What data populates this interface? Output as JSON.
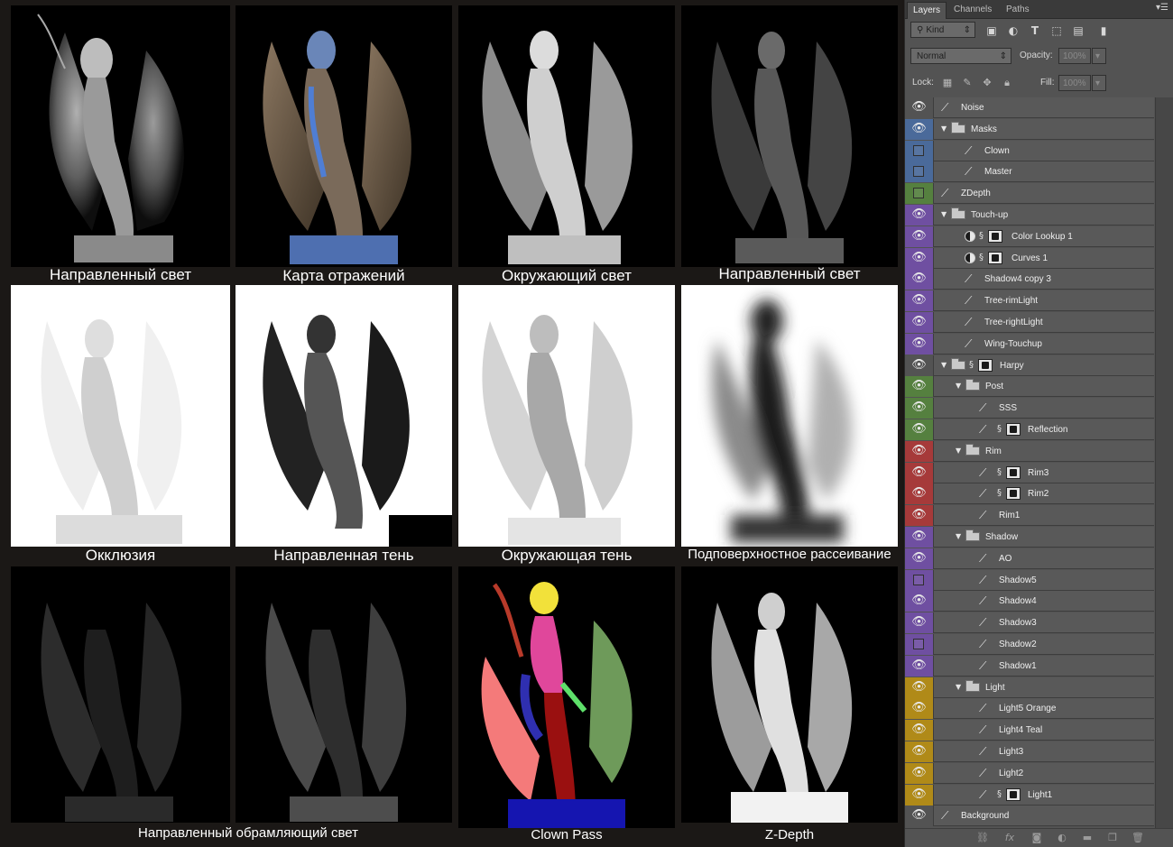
{
  "gallery": {
    "captions": [
      "Направленный свет",
      "Карта отражений",
      "Окружающий свет",
      "Направленный свет",
      "Окклюзия",
      "Направленная тень",
      "Окружающая тень",
      "Подповерхностное рассеивание",
      "Направленный обрамляющий свет",
      "Clown Pass",
      "Z-Depth"
    ]
  },
  "panel": {
    "tabs": [
      "Layers",
      "Channels",
      "Paths"
    ],
    "filter_kind": "Kind",
    "blend_mode": "Normal",
    "opacity_label": "Opacity:",
    "opacity_value": "100%",
    "lock_label": "Lock:",
    "fill_label": "Fill:",
    "fill_value": "100%"
  },
  "layers": [
    {
      "name": "Noise",
      "color": "none",
      "visible": true
    },
    {
      "name": "Masks",
      "color": "blue",
      "visible": true
    },
    {
      "name": "Clown",
      "color": "blue",
      "visible": false
    },
    {
      "name": "Master",
      "color": "blue",
      "visible": false
    },
    {
      "name": "ZDepth",
      "color": "green",
      "visible": false
    },
    {
      "name": "Touch-up",
      "color": "violet",
      "visible": true
    },
    {
      "name": "Color Lookup 1",
      "color": "violet",
      "visible": true
    },
    {
      "name": "Curves 1",
      "color": "violet",
      "visible": true
    },
    {
      "name": "Shadow4 copy 3",
      "color": "violet",
      "visible": true
    },
    {
      "name": "Tree-rimLight",
      "color": "violet",
      "visible": true
    },
    {
      "name": "Tree-rightLight",
      "color": "violet",
      "visible": true
    },
    {
      "name": "Wing-Touchup",
      "color": "violet",
      "visible": true
    },
    {
      "name": "Harpy",
      "color": "none",
      "visible": true
    },
    {
      "name": "Post",
      "color": "green",
      "visible": true
    },
    {
      "name": "SSS",
      "color": "green",
      "visible": true
    },
    {
      "name": "Reflection",
      "color": "green",
      "visible": true
    },
    {
      "name": "Rim",
      "color": "red",
      "visible": true
    },
    {
      "name": "Rim3",
      "color": "red",
      "visible": true
    },
    {
      "name": "Rim2",
      "color": "red",
      "visible": true
    },
    {
      "name": "Rim1",
      "color": "red",
      "visible": true
    },
    {
      "name": "Shadow",
      "color": "violet",
      "visible": true
    },
    {
      "name": "AO",
      "color": "violet",
      "visible": true
    },
    {
      "name": "Shadow5",
      "color": "violet",
      "visible": false
    },
    {
      "name": "Shadow4",
      "color": "violet",
      "visible": true
    },
    {
      "name": "Shadow3",
      "color": "violet",
      "visible": true
    },
    {
      "name": "Shadow2",
      "color": "violet",
      "visible": false
    },
    {
      "name": "Shadow1",
      "color": "violet",
      "visible": true
    },
    {
      "name": "Light",
      "color": "yellow",
      "visible": true
    },
    {
      "name": "Light5 Orange",
      "color": "yellow",
      "visible": true
    },
    {
      "name": "Light4 Teal",
      "color": "yellow",
      "visible": true
    },
    {
      "name": "Light3",
      "color": "yellow",
      "visible": true
    },
    {
      "name": "Light2",
      "color": "yellow",
      "visible": true
    },
    {
      "name": "Light1",
      "color": "yellow",
      "visible": true
    },
    {
      "name": "Background",
      "color": "none",
      "visible": true
    }
  ],
  "label_colors": {
    "blue": "#4a6a9a",
    "green": "#55803f",
    "violet": "#6f4fa1",
    "red": "#a63a3a",
    "yellow": "#b08a18",
    "none": "#535353"
  },
  "icons": {
    "eye": "eye-icon",
    "brush": "brush-icon",
    "folder": "folder-icon",
    "link": "link-icon",
    "mask": "mask-thumbnail-icon",
    "adjustment": "adjustment-layer-icon"
  }
}
